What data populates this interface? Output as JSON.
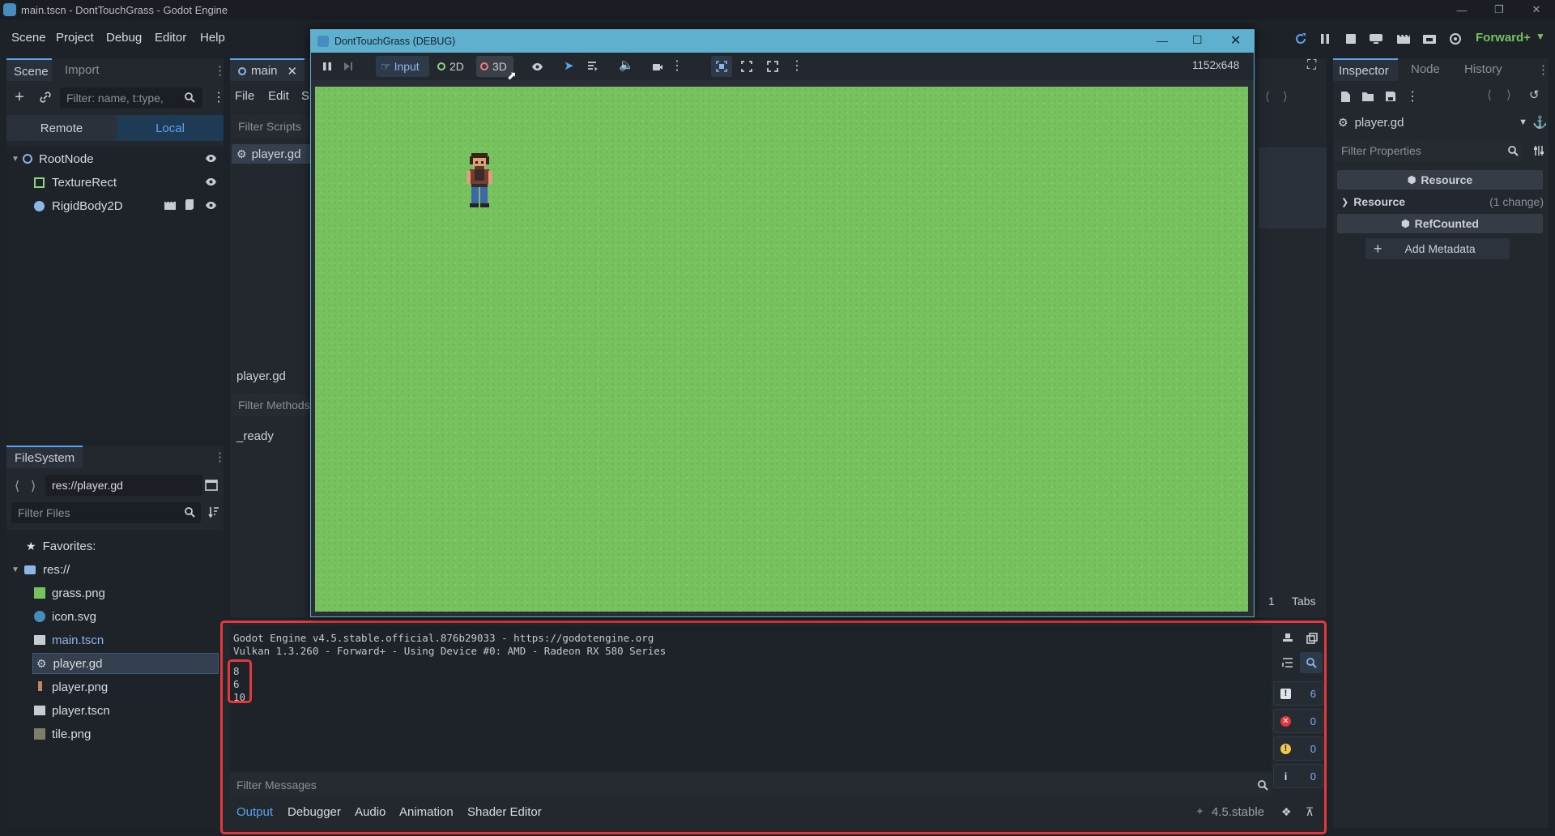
{
  "title_bar": {
    "text": "main.tscn - DontTouchGrass - Godot Engine"
  },
  "menus": [
    "Scene",
    "Project",
    "Debug",
    "Editor",
    "Help"
  ],
  "renderer": "Forward+",
  "scene_dock": {
    "tabs": [
      "Scene",
      "Import"
    ],
    "filter_placeholder": "Filter: name, t:type,",
    "remote_label": "Remote",
    "local_label": "Local",
    "nodes": [
      "RootNode",
      "TextureRect",
      "RigidBody2D"
    ]
  },
  "filesystem": {
    "tab": "FileSystem",
    "path": "res://player.gd",
    "filter_placeholder": "Filter Files",
    "favorites": "Favorites:",
    "root": "res://",
    "files": [
      "grass.png",
      "icon.svg",
      "main.tscn",
      "player.gd",
      "player.png",
      "player.tscn",
      "tile.png"
    ]
  },
  "script_editor": {
    "tab": "main",
    "menus": [
      "File",
      "Edit",
      "S"
    ],
    "filter_scripts": "Filter Scripts",
    "script_item": "player.gd",
    "current_script": "player.gd",
    "filter_methods": "Filter Methods",
    "method": "_ready",
    "line_number": "1",
    "tabs_label": "Tabs"
  },
  "game_window": {
    "title": "DontTouchGrass (DEBUG)",
    "input_label": "Input",
    "mode_2d": "2D",
    "mode_3d": "3D",
    "resolution": "1152x648"
  },
  "inspector": {
    "tabs": [
      "Inspector",
      "Node",
      "History"
    ],
    "resource_name": "player.gd",
    "filter_placeholder": "Filter Properties",
    "section_resource": "Resource",
    "prop_resource": "Resource",
    "prop_resource_value": "(1 change)",
    "section_refcounted": "RefCounted",
    "add_metadata": "Add Metadata"
  },
  "output": {
    "lines": [
      "Godot Engine v4.5.stable.official.876b29033 - https://godotengine.org",
      "Vulkan 1.3.260 - Forward+ - Using Device #0: AMD - Radeon RX 580 Series"
    ],
    "printed_values": [
      "8",
      "6",
      "10"
    ],
    "filter_placeholder": "Filter Messages",
    "counts": {
      "messages": "6",
      "errors": "0",
      "warnings": "0",
      "info": "0"
    },
    "bottom_tabs": [
      "Output",
      "Debugger",
      "Audio",
      "Animation",
      "Shader Editor"
    ],
    "version": "4.5.stable"
  },
  "colors": {
    "accent": "#5aa3f0",
    "grass": "#77c25f",
    "highlight": "#e5383b",
    "game_titlebar": "#5fb0cf"
  }
}
